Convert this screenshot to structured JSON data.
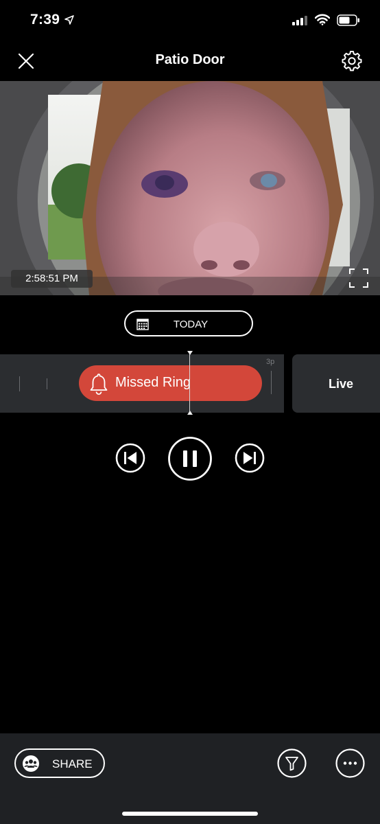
{
  "status_bar": {
    "time": "7:39"
  },
  "nav": {
    "title": "Patio Door",
    "close_icon": "close-icon",
    "settings_icon": "gear-icon"
  },
  "video": {
    "timestamp": "2:58:51 PM",
    "fullscreen_icon": "fullscreen-icon"
  },
  "date_selector": {
    "label": "TODAY",
    "icon": "calendar-icon"
  },
  "timeline": {
    "event_label": "Missed Ring",
    "event_icon": "bell-icon",
    "event_color": "#d3473a",
    "tick_label": "3p",
    "live_label": "Live"
  },
  "playback": {
    "prev_icon": "skip-previous-icon",
    "pause_icon": "pause-icon",
    "next_icon": "skip-next-icon"
  },
  "bottom_bar": {
    "share_label": "SHARE",
    "filter_icon": "filter-icon",
    "more_icon": "more-icon"
  }
}
